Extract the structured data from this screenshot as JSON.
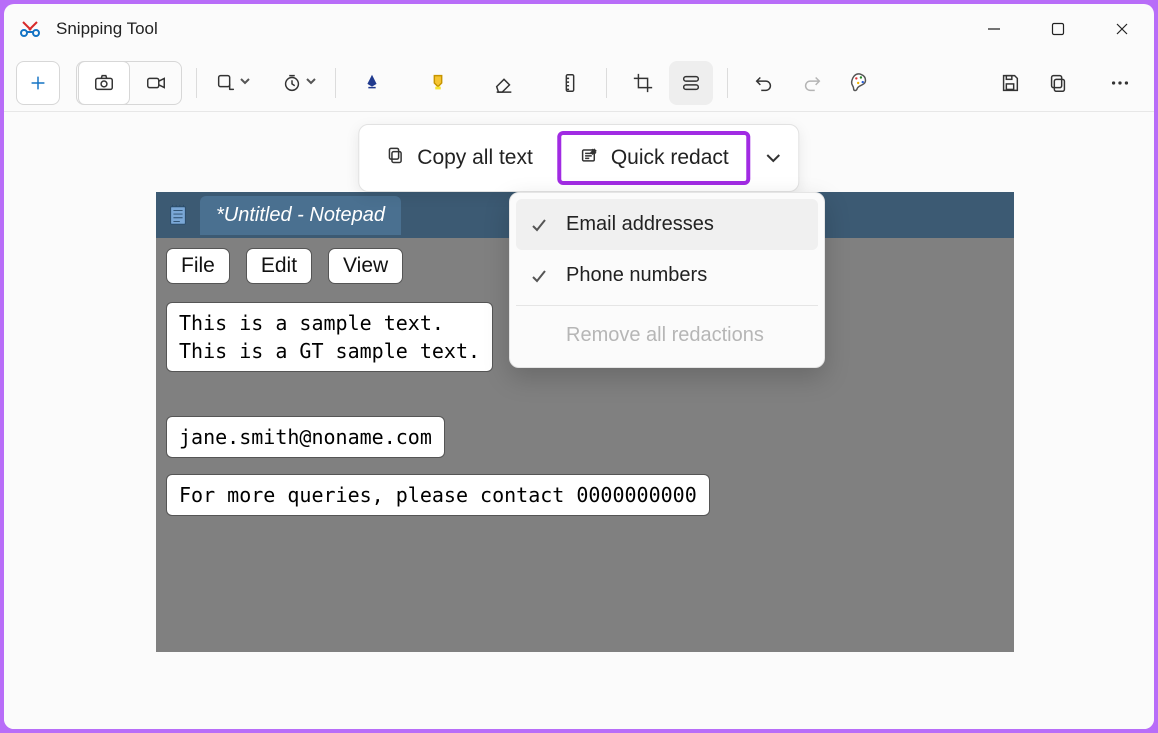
{
  "app": {
    "title": "Snipping Tool"
  },
  "textActions": {
    "copyAll": "Copy all text",
    "quickRedact": "Quick redact"
  },
  "redactMenu": {
    "emails": "Email addresses",
    "phones": "Phone numbers",
    "removeAll": "Remove all redactions"
  },
  "notepad": {
    "tab": "*Untitled - Notepad",
    "menus": {
      "file": "File",
      "edit": "Edit",
      "view": "View"
    },
    "line1": "This is a sample text.",
    "line2": "This is a GT sample text.",
    "email": "jane.smith@noname.com",
    "contact": "For more queries, please contact 0000000000"
  }
}
